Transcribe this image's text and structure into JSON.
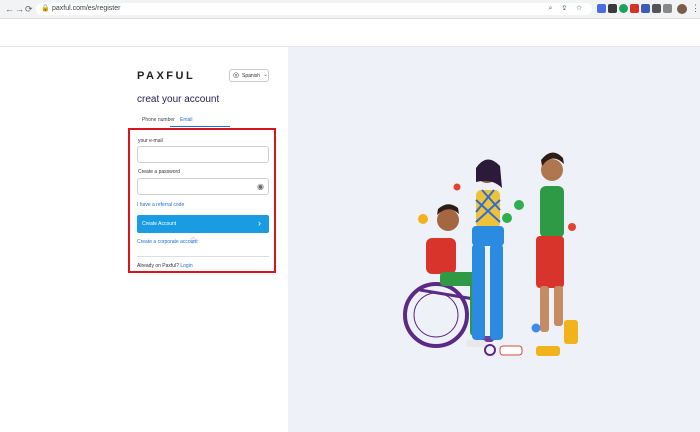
{
  "browser": {
    "url": "paxful.com/es/register",
    "nav": {
      "back": "←",
      "forward": "→",
      "reload": "⟳"
    },
    "lock_icon": "🔒",
    "omnibox_icons": "⌕ ⇪ ☆",
    "menu_icon": "⋮"
  },
  "header": {
    "logo": "PAXFUL",
    "language": {
      "selected": "Spanish",
      "icon": "globe-icon",
      "chevron": "⌄"
    }
  },
  "form": {
    "title": "creat your account",
    "tabs": [
      {
        "label": "Phone number"
      },
      {
        "label": "Email"
      }
    ],
    "email_label": "your e-mail",
    "email_value": "",
    "password_label": "Create a password",
    "password_value": "",
    "referral_link": "I have a referral code",
    "submit_label": "Create Account",
    "submit_chevron": "›",
    "corporate_link": "Create a corporate account",
    "corporate_info_icon": "ⓘ",
    "login_prompt": "Already on Paxful?",
    "login_link": "Login"
  },
  "colors": {
    "primary": "#1a9ce3",
    "link": "#1f6fd1",
    "highlight": "#d9141c",
    "title": "#2a2150",
    "panel_bg": "#eef2f8"
  }
}
